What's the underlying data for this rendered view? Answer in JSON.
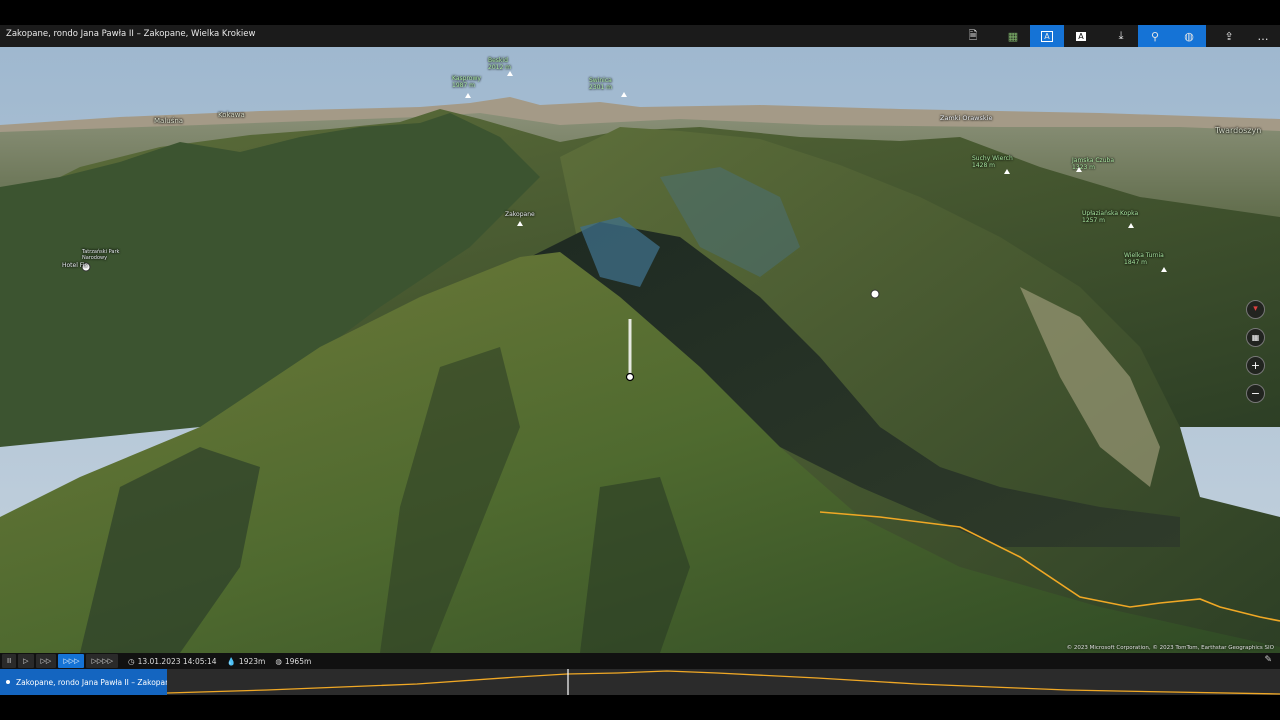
{
  "window": {
    "title": "Zakopane, rondo Jana Pawła II – Zakopane, Wielka Krokiew"
  },
  "toolbar": {
    "buttons": [
      {
        "name": "export-icon",
        "glyph": "🗎"
      },
      {
        "name": "terrain-icon",
        "glyph": "▦"
      },
      {
        "name": "labels-icon",
        "glyph": "A"
      },
      {
        "name": "labels-alt-icon",
        "glyph": "A"
      },
      {
        "name": "download-icon",
        "glyph": "⤓"
      },
      {
        "name": "pin-icon",
        "glyph": "⚲"
      },
      {
        "name": "globe-icon",
        "glyph": "◍"
      },
      {
        "name": "share-icon",
        "glyph": "⇪"
      },
      {
        "name": "more-icon",
        "glyph": "…"
      }
    ]
  },
  "map_labels": {
    "swinica": "Swinica\n2301 m",
    "kasprowy": "Kasprowy\n1987 m",
    "beskid": "Beskid\n2012 m",
    "zakopane": "Zakopane",
    "hotel": "Hotel Fis",
    "tatrzanski": "Tatrzański Park\nNarodowy",
    "suchy": "Suchy Wierch\n1428 m",
    "wielka_turnia": "Wielka Turnia\n1847 m",
    "malusin": "Maluśna",
    "kokawa": "Kokawa",
    "zamki": "Zamki Orawskie",
    "twardoszyn": "Twardoszyn",
    "upazna": "Upłaziańska Kopka\n1257 m",
    "wielka_czuba": "Jamska Czuba\n1323 m"
  },
  "map_controls": {
    "compass": "compass-icon",
    "tilt": "tilt-icon",
    "zoom_in": "+",
    "zoom_out": "−"
  },
  "copyright": "© 2023 Microsoft Corporation, © 2023 TomTom, Earthstar Geographics SIO",
  "playback": {
    "pause": "II",
    "play": "▷",
    "speed2": "▷▷",
    "speed3": "▷▷▷",
    "speed4": "▷▷▷▷",
    "datetime": "13.01.2023 14:05:14",
    "altitude": "1923m",
    "elevation": "1965m"
  },
  "elevation_profile": {
    "route_name": "Zakopane, rondo Jana Pawła II – Zakopane, W",
    "line_color": "#f0a825"
  }
}
